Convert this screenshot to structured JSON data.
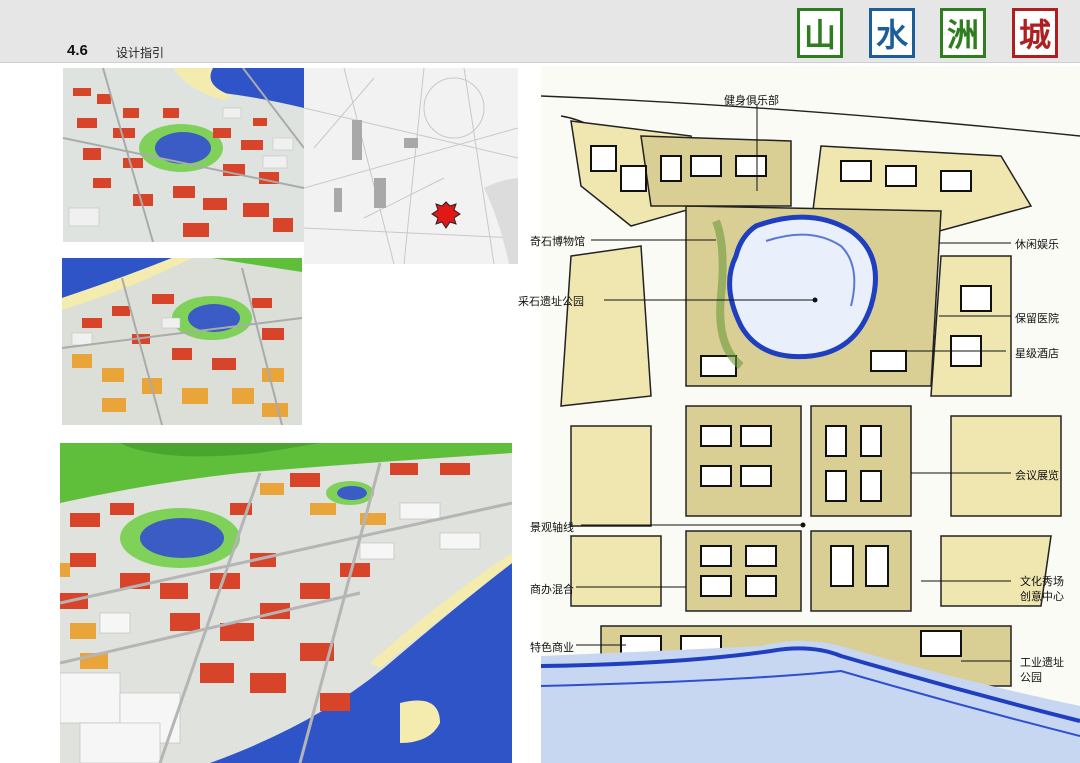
{
  "header": {
    "section_number": "4.6",
    "section_title": "设计指引"
  },
  "logo": {
    "chars": [
      {
        "char": "山",
        "color": "#2e7d1f"
      },
      {
        "char": "水",
        "color": "#1b5e9a"
      },
      {
        "char": "洲",
        "color": "#2e7d1f"
      },
      {
        "char": "城",
        "color": "#b01f1f"
      }
    ]
  },
  "plan_labels": {
    "fitness_club": "健身俱乐部",
    "stone_museum": "奇石博物馆",
    "quarry_park": "采石遗址公园",
    "leisure": "休闲娱乐",
    "preserved_hospital": "保留医院",
    "star_hotel": "星级酒店",
    "convention": "会议展览",
    "view_axis": "景观轴线",
    "mixed_commercial": "商办混合",
    "culture_show_1": "文化秀场",
    "culture_show_2": "创意中心",
    "specialty_commerce": "特色商业",
    "industrial_park_1": "工业遗址",
    "industrial_park_2": "公园"
  },
  "colors": {
    "header_bg": "#e6e6e6",
    "red_building": "#d8442a",
    "orange_building": "#e9a43a",
    "water": "#2f54c8",
    "green": "#5fbf3a"
  }
}
